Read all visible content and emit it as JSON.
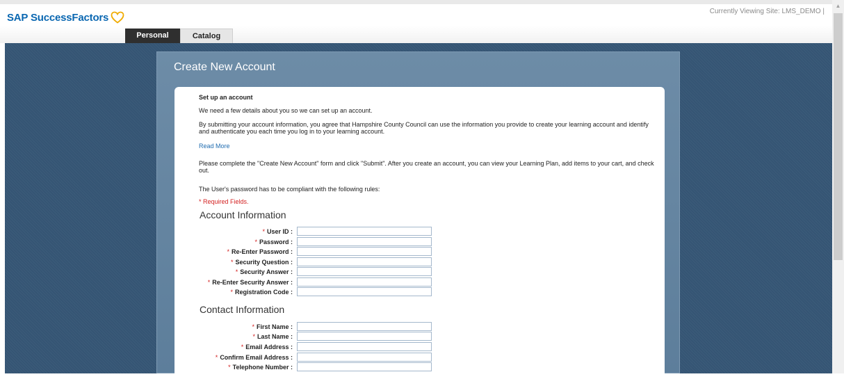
{
  "header": {
    "logo_text": "SAP SuccessFactors",
    "site_info": "Currently Viewing Site: LMS_DEMO |",
    "tabs": [
      {
        "label": "Personal",
        "active": true
      },
      {
        "label": "Catalog",
        "active": false
      }
    ]
  },
  "panel": {
    "title": "Create New Account",
    "setup_heading": "Set up an account",
    "intro": "We need a few details about you so we can set up an account.",
    "consent": "By submitting your account information, you agree that Hampshire County Council can use the information you provide to create your learning account and identify and authenticate you each time you log in to your learning account.",
    "read_more": "Read More",
    "instructions": "Please complete the \"Create New Account\" form and click \"Submit\". After you create an account, you can view your Learning Plan, add items to your cart, and check out.",
    "password_rules": "The User's password has to be compliant with the following rules:",
    "required_note": "* Required Fields."
  },
  "account_section": {
    "heading": "Account Information",
    "fields": [
      {
        "label": "User ID :",
        "value": ""
      },
      {
        "label": "Password :",
        "value": ""
      },
      {
        "label": "Re-Enter Password :",
        "value": ""
      },
      {
        "label": "Security Question :",
        "value": ""
      },
      {
        "label": "Security Answer :",
        "value": ""
      },
      {
        "label": "Re-Enter Security Answer :",
        "value": ""
      },
      {
        "label": "Registration Code :",
        "value": ""
      }
    ]
  },
  "contact_section": {
    "heading": "Contact Information",
    "fields": [
      {
        "label": "First Name :",
        "value": ""
      },
      {
        "label": "Last Name :",
        "value": ""
      },
      {
        "label": "Email Address :",
        "value": ""
      },
      {
        "label": "Confirm Email Address :",
        "value": ""
      },
      {
        "label": "Telephone Number :",
        "value": ""
      }
    ]
  },
  "required_marker": "*",
  "colors": {
    "brand": "#0a67b1",
    "page_background": "#355574",
    "panel": "#6d8ca7",
    "required": "#d32121",
    "link": "#1f6cb0"
  }
}
